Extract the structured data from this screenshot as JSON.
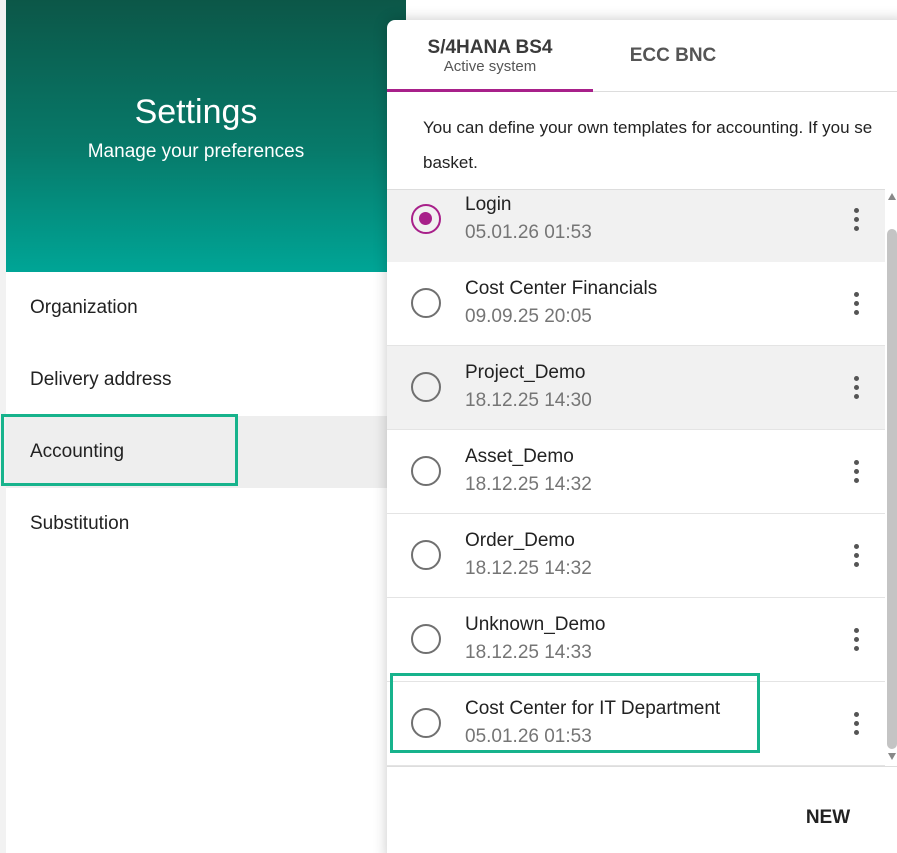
{
  "header": {
    "title": "Settings",
    "subtitle": "Manage your preferences"
  },
  "nav": {
    "items": [
      {
        "label": "Organization"
      },
      {
        "label": "Delivery address"
      },
      {
        "label": "Accounting",
        "active": true
      },
      {
        "label": "Substitution"
      }
    ]
  },
  "tabs": [
    {
      "label": "S/4HANA BS4",
      "sublabel": "Active system",
      "active": true
    },
    {
      "label": "ECC BNC"
    }
  ],
  "description": {
    "line1": "You can define your own templates for accounting. If you se",
    "line2": "basket."
  },
  "templates": [
    {
      "name": "Login",
      "date": "05.01.26 01:53",
      "selected": true
    },
    {
      "name": "Cost Center Financials",
      "date": "09.09.25 20:05",
      "selected": false
    },
    {
      "name": "Project_Demo",
      "date": "18.12.25 14:30",
      "selected": false
    },
    {
      "name": "Asset_Demo",
      "date": "18.12.25 14:32",
      "selected": false
    },
    {
      "name": "Order_Demo",
      "date": "18.12.25 14:32",
      "selected": false
    },
    {
      "name": "Unknown_Demo",
      "date": "18.12.25 14:33",
      "selected": false
    },
    {
      "name": "Cost Center for IT Department",
      "date": "05.01.26 01:53",
      "selected": false
    }
  ],
  "footer": {
    "new_label": "NEW"
  },
  "colors": {
    "accent": "#a8208a",
    "highlight": "#17b38c",
    "header_top": "#0c5748",
    "header_bottom": "#00a596"
  }
}
